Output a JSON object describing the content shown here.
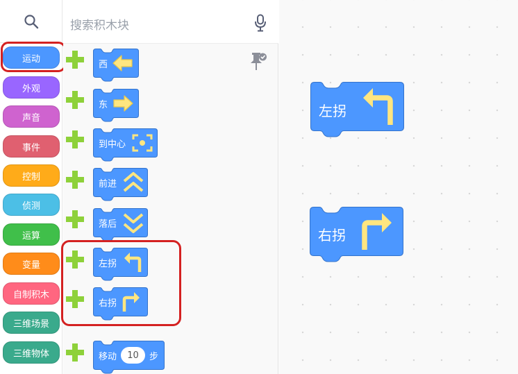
{
  "categories": {
    "search_icon": "search-icon",
    "items": [
      {
        "label": "运动",
        "color": "#4c97ff"
      },
      {
        "label": "外观",
        "color": "#9966ff"
      },
      {
        "label": "声音",
        "color": "#cf63cf"
      },
      {
        "label": "事件",
        "color": "#e06070"
      },
      {
        "label": "控制",
        "color": "#ffab19"
      },
      {
        "label": "侦测",
        "color": "#4cbfe6"
      },
      {
        "label": "运算",
        "color": "#40bf4a"
      },
      {
        "label": "变量",
        "color": "#ff8c1a"
      },
      {
        "label": "自制积木",
        "color": "#ff6680"
      },
      {
        "label": "三维场景",
        "color": "#3aaa8c"
      },
      {
        "label": "三维物体",
        "color": "#3aaa8c"
      }
    ],
    "selected": "运动"
  },
  "palette": {
    "search_placeholder": "搜索积木块",
    "mic_icon": "microphone-icon",
    "pin_icon": "pin-icon",
    "blocks": [
      {
        "label": "西",
        "icon": "arrow-left-icon"
      },
      {
        "label": "东",
        "icon": "arrow-right-icon"
      },
      {
        "label": "到中心",
        "icon": "center-target-icon"
      },
      {
        "label": "前进",
        "icon": "chevron-double-up-icon"
      },
      {
        "label": "落后",
        "icon": "chevron-double-down-icon"
      },
      {
        "label": "左拐",
        "icon": "turn-left-icon"
      },
      {
        "label": "右拐",
        "icon": "turn-right-icon"
      },
      {
        "label": "移动",
        "value": "10",
        "suffix": "步"
      }
    ]
  },
  "workspace": {
    "blocks": [
      {
        "label": "左拐",
        "icon": "turn-left-icon"
      },
      {
        "label": "右拐",
        "icon": "turn-right-icon"
      }
    ]
  },
  "colors": {
    "motion_block": "#4c97ff",
    "block_border": "#3373cc",
    "plus": "#8ed13a",
    "icon_yellow": "#ffe680",
    "highlight": "#d42121"
  }
}
